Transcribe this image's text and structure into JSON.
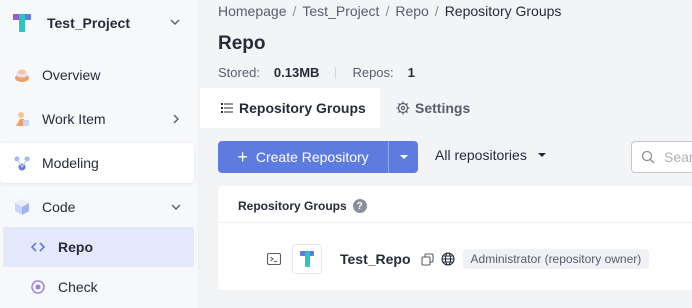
{
  "sidebar": {
    "project_name": "Test_Project",
    "items": [
      {
        "label": "Overview",
        "icon": "overview-icon"
      },
      {
        "label": "Work Item",
        "icon": "work-item-icon"
      },
      {
        "label": "Modeling",
        "icon": "modeling-icon"
      },
      {
        "label": "Code",
        "icon": "code-icon"
      }
    ],
    "sub_items": [
      {
        "label": "Repo",
        "icon": "repo-icon"
      },
      {
        "label": "Check",
        "icon": "check-icon"
      }
    ]
  },
  "breadcrumb": [
    "Homepage",
    "Test_Project",
    "Repo",
    "Repository Groups"
  ],
  "breadcrumb_separator": "/",
  "page": {
    "title": "Repo",
    "stored_label": "Stored:",
    "stored_value": "0.13MB",
    "repos_label": "Repos:",
    "repos_value": "1"
  },
  "tabs": [
    {
      "label": "Repository Groups",
      "icon": "list-icon"
    },
    {
      "label": "Settings",
      "icon": "gear-icon"
    }
  ],
  "toolbar": {
    "create_label": "Create Repository",
    "filter_label": "All repositories",
    "search_placeholder": "Sear"
  },
  "card": {
    "header": "Repository Groups",
    "help": "?",
    "repos": [
      {
        "name": "Test_Repo",
        "role": "Administrator (repository owner)"
      }
    ]
  },
  "colors": {
    "primary": "#5e7ce0",
    "selected_bg": "#e3e9fb",
    "text": "#252b3a"
  }
}
